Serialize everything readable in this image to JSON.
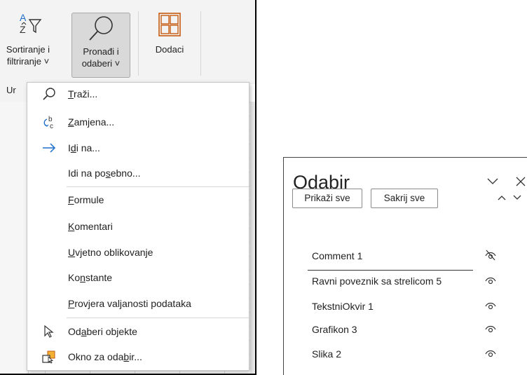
{
  "ribbon": {
    "sort_filter": {
      "line1": "Sortiranje i",
      "line2": "filtriranje ˅"
    },
    "find_select": {
      "line1": "Pronađi i",
      "line2": "odaberi ˅"
    },
    "addins": {
      "label": "Dodaci"
    },
    "group_label": "Ur"
  },
  "menu": {
    "items": [
      {
        "icon": "search-icon",
        "pre": "",
        "acc": "T",
        "post": "raži..."
      },
      {
        "icon": "replace-icon",
        "pre": "",
        "acc": "Z",
        "post": "amjena..."
      },
      {
        "icon": "arrow-right-icon",
        "pre": "I",
        "acc": "d",
        "post": "i na..."
      },
      {
        "icon": "",
        "pre": "Idi na po",
        "acc": "s",
        "post": "ebno..."
      },
      {
        "icon": "",
        "pre": "",
        "acc": "F",
        "post": "ormule"
      },
      {
        "icon": "",
        "pre": "",
        "acc": "K",
        "post": "omentari"
      },
      {
        "icon": "",
        "pre": "",
        "acc": "U",
        "post": "vjetno oblikovanje"
      },
      {
        "icon": "",
        "pre": "Ko",
        "acc": "n",
        "post": "stante"
      },
      {
        "icon": "",
        "pre": "",
        "acc": "P",
        "post": "rovjera valjanosti podataka"
      },
      {
        "icon": "cursor-arrow-icon",
        "pre": "Od",
        "acc": "a",
        "post": "beri objekte"
      },
      {
        "icon": "selection-pane-icon",
        "pre": "Okno za oda",
        "acc": "b",
        "post": "ir..."
      }
    ]
  },
  "pane": {
    "title": "Odabir",
    "show_all": "Prikaži sve",
    "hide_all": "Sakrij sve",
    "rows": [
      {
        "name": "Comment 1",
        "visibility": "hidden"
      },
      {
        "name": "Ravni poveznik sa strelicom 5",
        "visibility": "visible"
      },
      {
        "name": "TekstniOkvir 1",
        "visibility": "visible"
      },
      {
        "name": "Grafikon 3",
        "visibility": "visible"
      },
      {
        "name": "Slika 2",
        "visibility": "visible"
      }
    ]
  },
  "colors": {
    "addins_accent": "#c55a11",
    "arrow_accent": "#1e6fc9",
    "replace_accent": "#1e6fc9"
  }
}
